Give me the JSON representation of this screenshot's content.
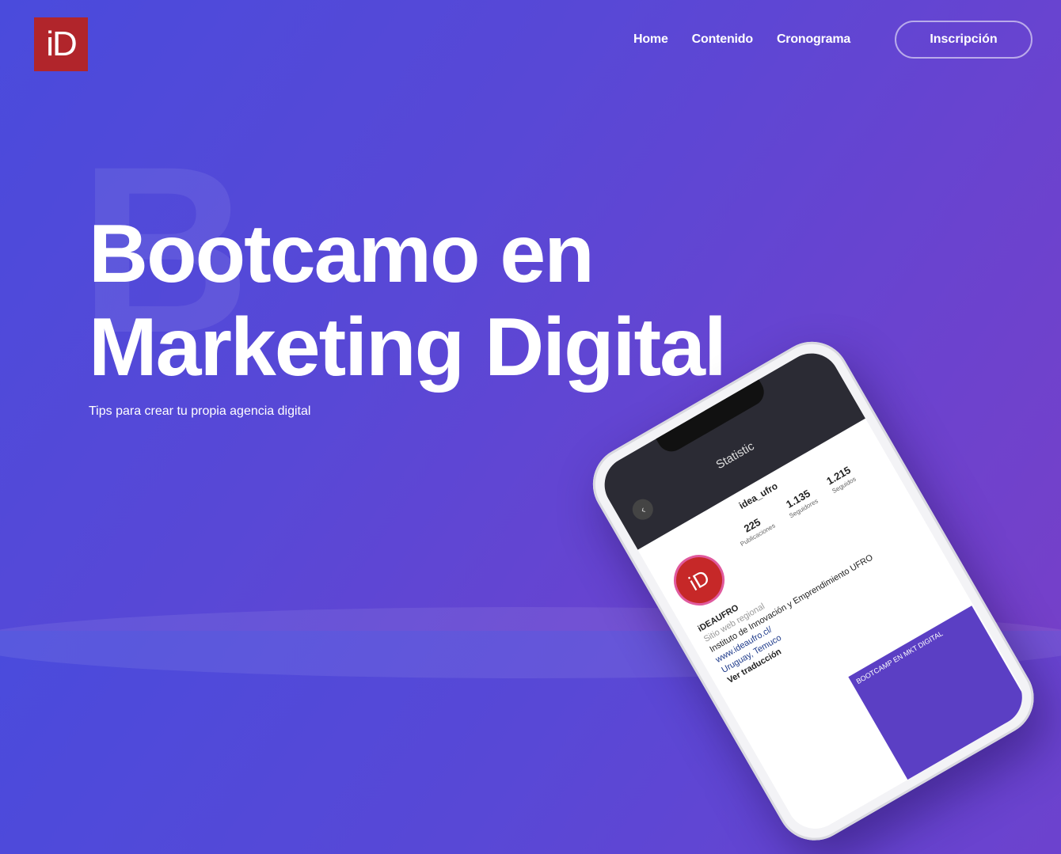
{
  "brand": {
    "logo_text": "iD",
    "logo_color": "#b1252b"
  },
  "nav": {
    "items": [
      {
        "label": "Home"
      },
      {
        "label": "Contenido"
      },
      {
        "label": "Cronograma"
      }
    ],
    "cta_label": "Inscripción"
  },
  "hero": {
    "ghost_letter": "B",
    "title": "Bootcamo en Marketing Digital",
    "subtitle": "Tips para crear tu propia agencia digital"
  },
  "phone": {
    "screen_title": "Statistic",
    "username": "idea_ufro",
    "stats": [
      {
        "value": "225",
        "label": "Publicaciones"
      },
      {
        "value": "1.135",
        "label": "Seguidores"
      },
      {
        "value": "1.215",
        "label": "Seguidos"
      }
    ],
    "avatar_text": "iD",
    "bio_name": "iDEAUFRO",
    "bio_category": "Sitio web regional",
    "bio_line1": "Instituto de Innovación y Emprendimiento UFRO",
    "bio_link": "www.ideaufro.cl/",
    "bio_location": "Uruguay, Temuco",
    "bio_translate": "Ver traducción",
    "banner_text": "BOOTCAMP EN MKT DIGITAL"
  },
  "colors": {
    "bg_start": "#4a4bdc",
    "bg_end": "#7540c9"
  }
}
